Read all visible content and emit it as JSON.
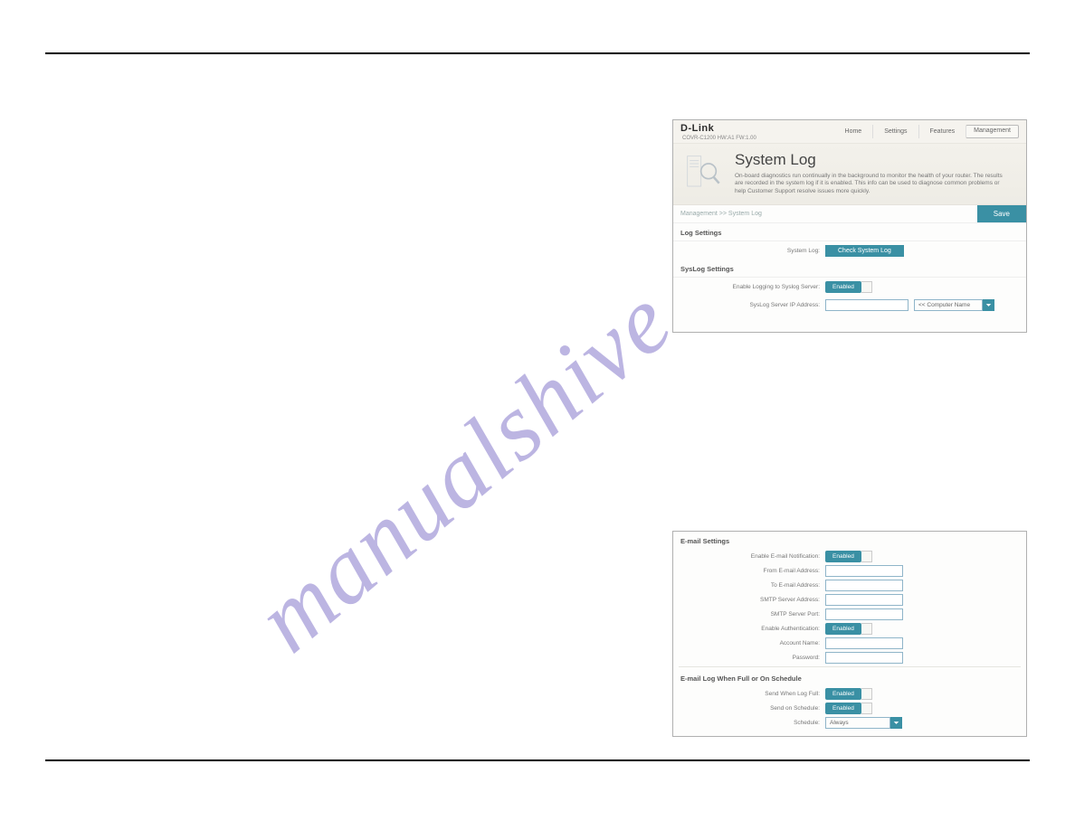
{
  "watermark": "manualshive.com",
  "shot1": {
    "brand": "D-Link",
    "subbrand": "COVR-C1200 HW:A1 FW:1.00",
    "nav": {
      "home": "Home",
      "settings": "Settings",
      "features": "Features",
      "management": "Management"
    },
    "title": "System Log",
    "desc": "On-board diagnostics run continually in the background to monitor the health of your router. The results are recorded in the system log if it is enabled. This info can be used to diagnose common problems or help Customer Support resolve issues more quickly.",
    "crumb": "Management >> System Log",
    "save": "Save",
    "logSettingsHeader": "Log Settings",
    "systemLogLabel": "System Log:",
    "checkSystemLog": "Check System Log",
    "syslogSettingsHeader": "SysLog Settings",
    "enableLoggingLabel": "Enable Logging to Syslog Server:",
    "enabled": "Enabled",
    "ipLabel": "SysLog Server IP Address:",
    "computerName": "<< Computer Name"
  },
  "shot2": {
    "emailHeader": "E-mail Settings",
    "enableEmailLabel": "Enable E-mail Notification:",
    "enabled": "Enabled",
    "fromLabel": "From E-mail Address:",
    "toLabel": "To E-mail Address:",
    "smtpAddrLabel": "SMTP Server Address:",
    "smtpPortLabel": "SMTP Server Port:",
    "enableAuthLabel": "Enable Authentication:",
    "accountLabel": "Account Name:",
    "passwordLabel": "Password:",
    "fullHeader": "E-mail Log When Full or On Schedule",
    "sendFullLabel": "Send When Log Full:",
    "sendSchedLabel": "Send on Schedule:",
    "scheduleLabel": "Schedule:",
    "scheduleValue": "Always"
  }
}
